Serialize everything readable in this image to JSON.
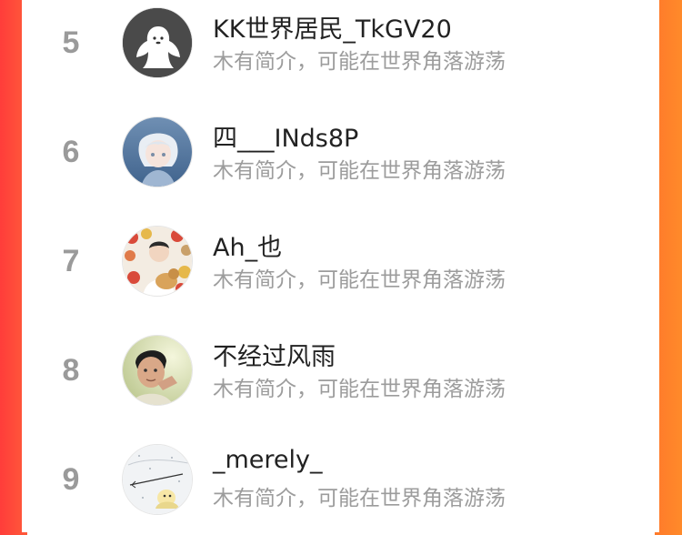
{
  "ranking": {
    "rows": [
      {
        "rank": "5",
        "name": "KK世界居民_TkGV20",
        "desc": "木有简介，可能在世界角落游荡",
        "avatar": "default-ghost-avatar"
      },
      {
        "rank": "6",
        "name": "四___INds8P",
        "desc": "木有简介，可能在世界角落游荡",
        "avatar": "anime-boy-avatar"
      },
      {
        "rank": "7",
        "name": "Ah_也",
        "desc": "木有简介，可能在世界角落游荡",
        "avatar": "boy-with-dog-avatar"
      },
      {
        "rank": "8",
        "name": "不经过风雨",
        "desc": "木有简介，可能在世界角落游荡",
        "avatar": "child-photo-avatar"
      },
      {
        "rank": "9",
        "name": "_merely_",
        "desc": "木有简介，可能在世界角落游荡",
        "avatar": "winter-sketch-avatar"
      }
    ]
  },
  "colors": {
    "left_edge": "#ff3d3a",
    "right_edge": "#ff7a2b",
    "rank_gray": "#9a9a9a",
    "name_text": "#222222",
    "desc_text": "#9c9c9c"
  }
}
